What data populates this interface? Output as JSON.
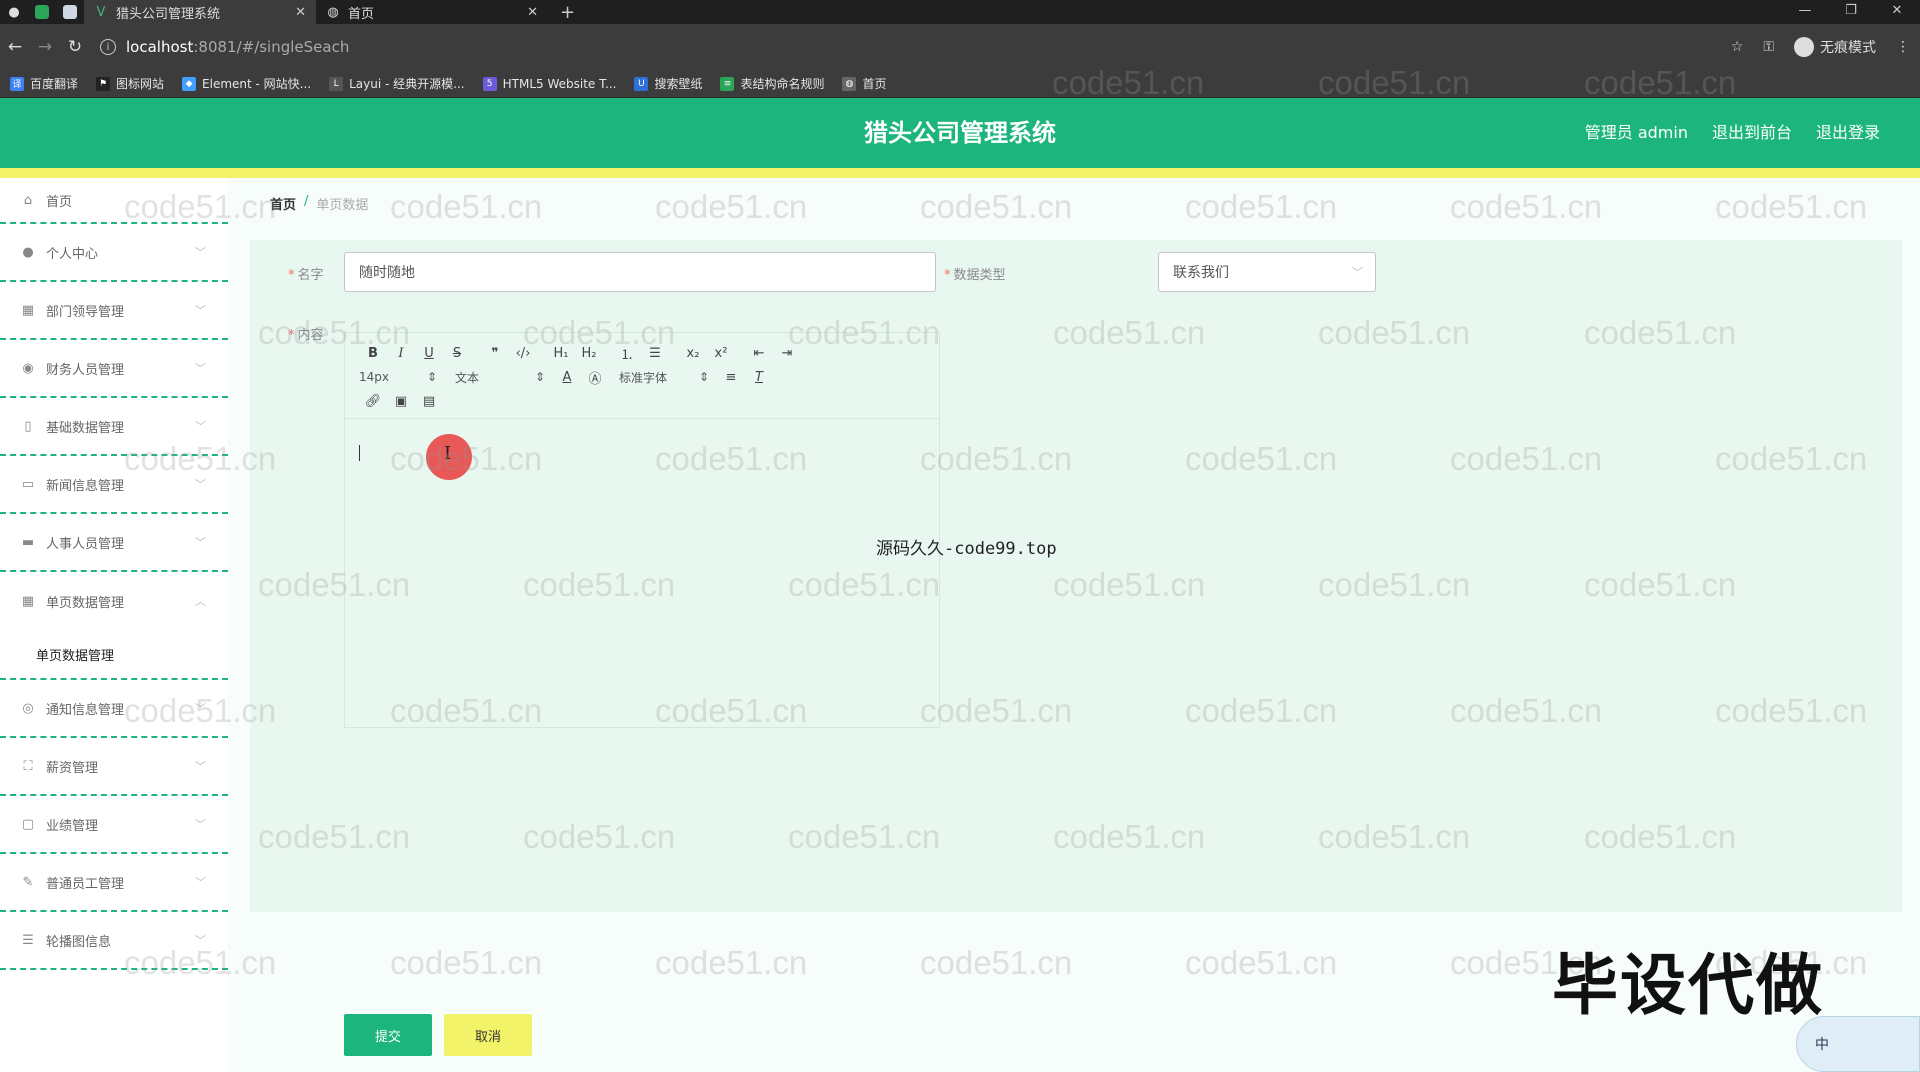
{
  "browser": {
    "tabs": [
      {
        "title": "猎头公司管理系统",
        "active": true
      },
      {
        "title": "首页",
        "active": false
      }
    ],
    "url_host": "localhost",
    "url_path": ":8081/#/singleSeach",
    "incognito_label": "无痕模式",
    "bookmarks": [
      "百度翻译",
      "图标网站",
      "Element - 网站快...",
      "Layui - 经典开源模...",
      "HTML5 Website T...",
      "搜索壁纸",
      "表结构命名规则",
      "首页"
    ]
  },
  "header": {
    "title": "猎头公司管理系统",
    "admin": "管理员 admin",
    "to_front": "退出到前台",
    "logout": "退出登录"
  },
  "sidebar": {
    "items": [
      {
        "label": "首页",
        "icon": "home-icon"
      },
      {
        "label": "个人中心",
        "icon": "user-icon"
      },
      {
        "label": "部门领导管理",
        "icon": "grid-icon"
      },
      {
        "label": "财务人员管理",
        "icon": "pin-icon"
      },
      {
        "label": "基础数据管理",
        "icon": "mic-icon"
      },
      {
        "label": "新闻信息管理",
        "icon": "news-icon"
      },
      {
        "label": "人事人员管理",
        "icon": "monitor-icon"
      },
      {
        "label": "单页数据管理",
        "icon": "apps-icon"
      },
      {
        "label": "通知信息管理",
        "icon": "globe-icon"
      },
      {
        "label": "薪资管理",
        "icon": "frame-icon"
      },
      {
        "label": "业绩管理",
        "icon": "chat-icon"
      },
      {
        "label": "普通员工管理",
        "icon": "edit-icon"
      },
      {
        "label": "轮播图信息",
        "icon": "list-icon"
      }
    ],
    "submenu_label": "单页数据管理"
  },
  "breadcrumb": {
    "home": "首页",
    "separator": "/",
    "current": "单页数据"
  },
  "form": {
    "name_label": "名字",
    "name_value": "随时随地",
    "type_label": "数据类型",
    "type_value": "联系我们",
    "content_label": "内容",
    "toolbar": {
      "font_size": "14px",
      "text_style": "文本",
      "font_family": "标准字体"
    },
    "submit": "提交",
    "cancel": "取消"
  },
  "overlays": {
    "center_note": "源码久久-code99.top",
    "watermark": "code51.cn",
    "big_mark": "毕设代做",
    "ime_label": "中"
  },
  "colors": {
    "brand_green": "#1cb57d",
    "accent_yellow": "#f3f36a",
    "required_red": "#f56c6c"
  }
}
